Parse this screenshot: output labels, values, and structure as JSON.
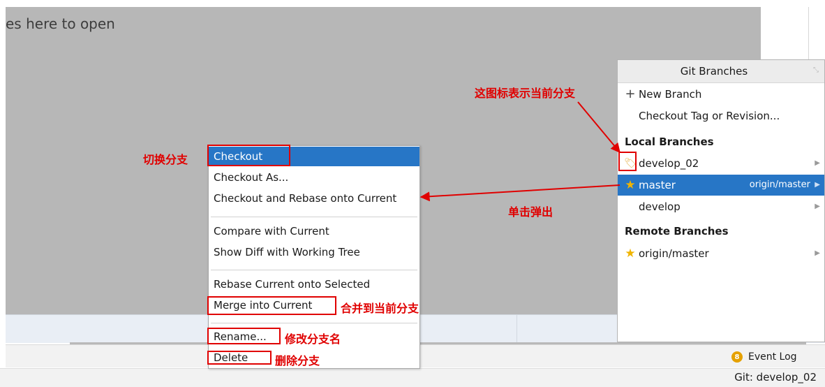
{
  "editor": {
    "hint": "es here to open"
  },
  "context_menu": {
    "items": [
      {
        "label": "Checkout",
        "selected": true
      },
      {
        "label": "Checkout As..."
      },
      {
        "label": "Checkout and Rebase onto Current"
      },
      {
        "label": "Compare with Current"
      },
      {
        "label": "Show Diff with Working Tree"
      },
      {
        "label": "Rebase Current onto Selected"
      },
      {
        "label": "Merge into Current"
      },
      {
        "label": "Rename..."
      },
      {
        "label": "Delete"
      }
    ]
  },
  "git_branches": {
    "title": "Git Branches",
    "new_branch": "New Branch",
    "checkout_tag": "Checkout Tag or Revision...",
    "local_header": "Local Branches",
    "local": [
      {
        "name": "develop_02",
        "icon": "tag-icon"
      },
      {
        "name": "master",
        "icon": "star-icon",
        "tracking": "origin/master",
        "selected": true
      },
      {
        "name": "develop"
      }
    ],
    "remote_header": "Remote Branches",
    "remote": [
      {
        "name": "origin/master",
        "icon": "star-icon"
      }
    ]
  },
  "annotations": {
    "current_branch_icon": "这图标表示当前分支",
    "switch_branch": "切换分支",
    "click_popup": "单击弹出",
    "merge_current": "合并到当前分支",
    "rename_branch": "修改分支名",
    "delete_branch": "删除分支"
  },
  "status": {
    "event_log_count": "8",
    "event_log": "Event Log",
    "git_branch": "Git: develop_02"
  },
  "colors": {
    "selection": "#2776c6",
    "annotation": "#e00000",
    "star": "#f0b400"
  }
}
